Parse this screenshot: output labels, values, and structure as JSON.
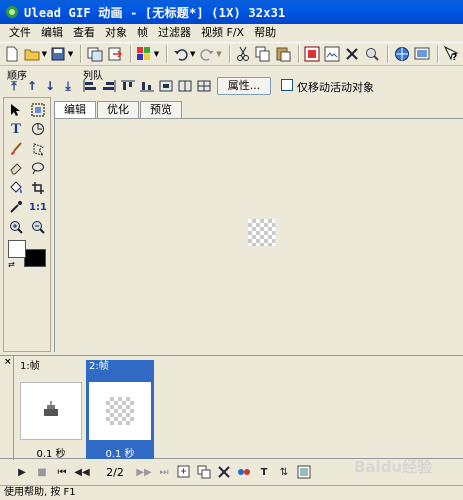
{
  "window": {
    "title": "Ulead GIF 动画 - [无标题*] (1X) 32x31"
  },
  "menu": [
    "文件",
    "编辑",
    "查看",
    "对象",
    "帧",
    "过滤器",
    "视频 F/X",
    "帮助"
  ],
  "toolbar": {
    "icons": [
      "new-icon",
      "open-icon",
      "save-icon",
      "add-images-icon",
      "export-icon",
      "optimize-icon",
      "undo-icon",
      "redo-icon",
      "cut-icon",
      "copy-icon",
      "paste-icon",
      "frame-properties-icon",
      "crop-icon",
      "delete-icon",
      "zoom-icon",
      "web-icon",
      "preview-icon",
      "help-icon"
    ]
  },
  "toolbar2": {
    "order_label": "顺序",
    "queue_label": "列队",
    "properties_button": "属性...",
    "checkbox_label": "仅移动活动对象",
    "checkbox_checked": false
  },
  "tabs": [
    {
      "label": "编辑",
      "active": true
    },
    {
      "label": "优化",
      "active": false
    },
    {
      "label": "预览",
      "active": false
    }
  ],
  "tools": [
    "pointer-tool",
    "marquee-tool",
    "text-tool",
    "transform-tool",
    "brush-tool",
    "lasso-tool",
    "eraser-tool",
    "clone-tool",
    "fill-tool",
    "crop-tool",
    "eyedropper-tool",
    "ruler-tool",
    "zoom-in-tool",
    "zoom-out-tool"
  ],
  "colors": {
    "foreground": "#ffffff",
    "background": "#000000",
    "selection": "#316ac5"
  },
  "frames": [
    {
      "label": "1:帧",
      "delay": "0.1 秒",
      "selected": false
    },
    {
      "label": "2:帧",
      "delay": "0.1 秒",
      "selected": true
    }
  ],
  "player": {
    "counter": "2/2"
  },
  "status": {
    "text": "使用帮助, 按 F1"
  },
  "watermark": "Baidu经验"
}
